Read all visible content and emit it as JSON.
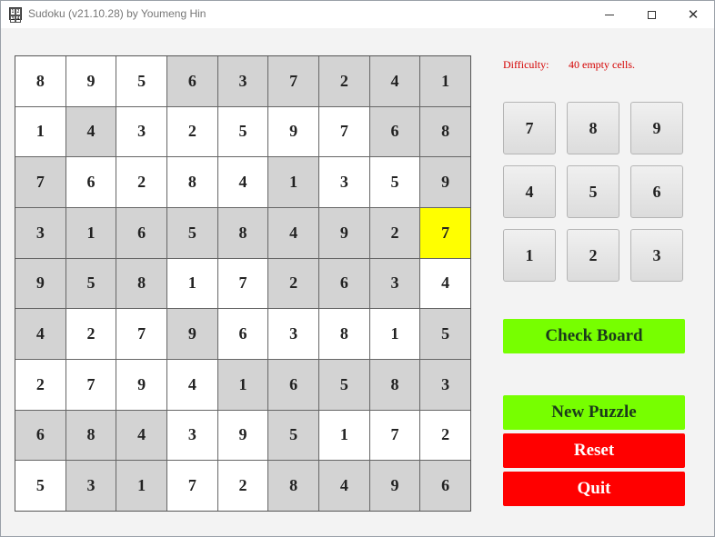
{
  "window": {
    "title": "Sudoku (v21.10.28) by Youmeng Hin",
    "icon_digits": [
      "1",
      "2",
      "3",
      "4"
    ]
  },
  "board": {
    "values": [
      [
        8,
        9,
        5,
        6,
        3,
        7,
        2,
        4,
        1
      ],
      [
        1,
        4,
        3,
        2,
        5,
        9,
        7,
        6,
        8
      ],
      [
        7,
        6,
        2,
        8,
        4,
        1,
        3,
        5,
        9
      ],
      [
        3,
        1,
        6,
        5,
        8,
        4,
        9,
        2,
        7
      ],
      [
        9,
        5,
        8,
        1,
        7,
        2,
        6,
        3,
        4
      ],
      [
        4,
        2,
        7,
        9,
        6,
        3,
        8,
        1,
        5
      ],
      [
        2,
        7,
        9,
        4,
        1,
        6,
        5,
        8,
        3
      ],
      [
        6,
        8,
        4,
        3,
        9,
        5,
        1,
        7,
        2
      ],
      [
        5,
        3,
        1,
        7,
        2,
        8,
        4,
        9,
        6
      ]
    ],
    "shade": [
      "wwwgggggg",
      "wgwwwwwgg",
      "gwwwwgwwg",
      "gggggggggs",
      "gggwwgggw",
      "gwwgwwwwg",
      "wwwwggggg",
      "gggwwgwww",
      "wggwwgggg"
    ],
    "selected_cell": {
      "row": 3,
      "col": 8
    },
    "colors": {
      "given": "#d3d3d3",
      "empty": "#ffffff",
      "selected": "#ffff00"
    }
  },
  "difficulty": {
    "label": "Difficulty:",
    "value": "40 empty cells."
  },
  "numpad": [
    "7",
    "8",
    "9",
    "4",
    "5",
    "6",
    "1",
    "2",
    "3"
  ],
  "buttons": {
    "check": "Check Board",
    "new_puzzle": "New Puzzle",
    "reset": "Reset",
    "quit": "Quit"
  },
  "colors": {
    "green_button": "#77ff00",
    "red_button": "#ff0000",
    "difficulty_text": "#d40000"
  }
}
